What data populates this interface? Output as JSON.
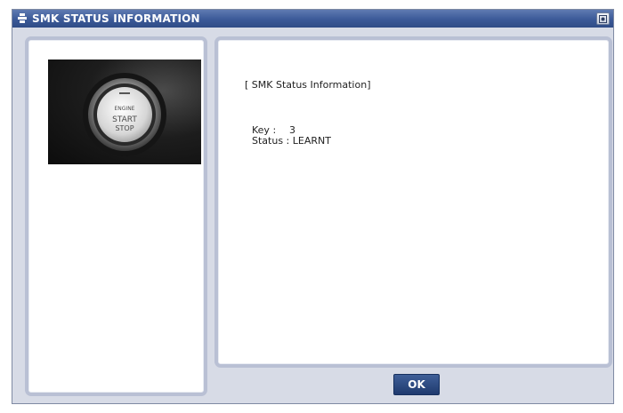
{
  "window": {
    "title": "SMK STATUS INFORMATION",
    "title_icon": "app-icon",
    "title_button_icon": "window-button-icon"
  },
  "photo": {
    "button_text_line1": "ENGINE",
    "button_text_line2": "START",
    "button_text_line3": "STOP"
  },
  "info": {
    "heading": "[ SMK Status Information]",
    "key_label": "Key :",
    "key_value": "3",
    "status_label": "Status :",
    "status_value": "LEARNT"
  },
  "buttons": {
    "ok_label": "OK"
  },
  "colors": {
    "titlebar": "#3b5998",
    "panel_border": "#b9c0d4",
    "ok_button": "#2a4a84"
  }
}
